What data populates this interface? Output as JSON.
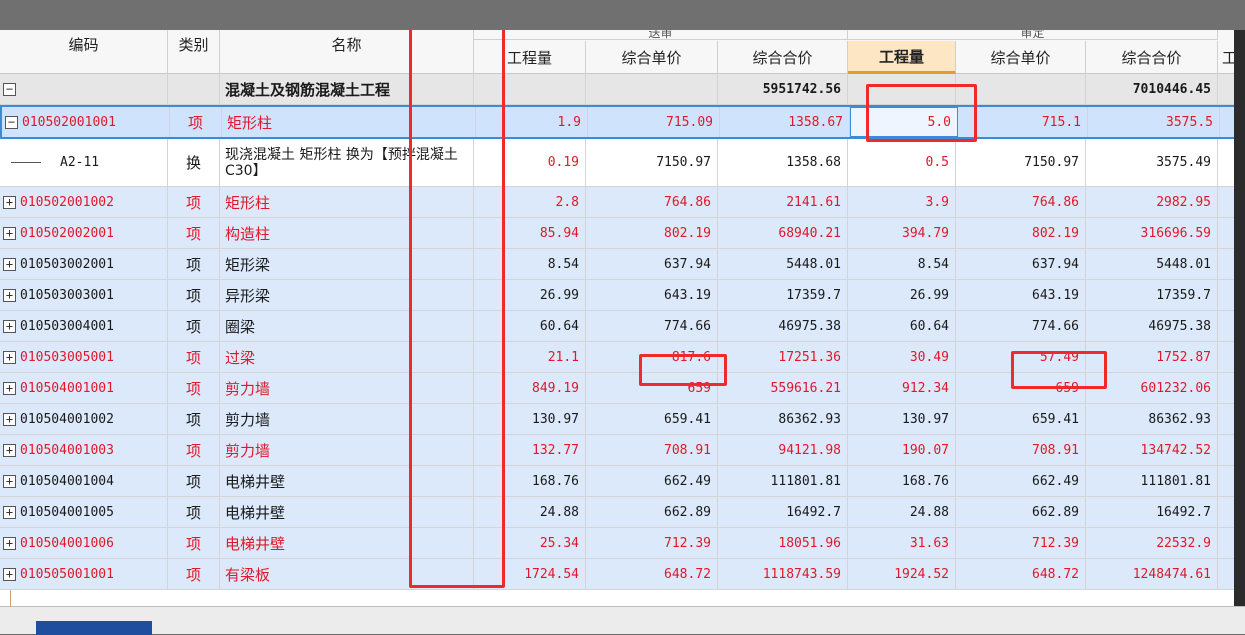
{
  "header": {
    "code": "编码",
    "type": "类别",
    "name": "名称",
    "group1": "送审",
    "group2": "审定",
    "g1": [
      "工程量",
      "综合单价",
      "综合合价"
    ],
    "g2": [
      "工程量",
      "综合单价",
      "综合合价"
    ],
    "cut": "工"
  },
  "rows": [
    {
      "code": "",
      "type": "",
      "name": "混凝土及钢筋混凝土工程",
      "v": [
        "",
        "",
        "5951742.56",
        "",
        "",
        "7010446.45"
      ]
    },
    {
      "code": "010502001001",
      "type": "项",
      "name": "矩形柱",
      "v": [
        "1.9",
        "715.09",
        "1358.67",
        "5.0",
        "715.1",
        "3575.5"
      ]
    },
    {
      "code": "A2-11",
      "type": "换",
      "name": "现浇混凝土 矩形柱  换为【预拌混凝土 C30】",
      "v": [
        "0.19",
        "7150.97",
        "1358.68",
        "0.5",
        "7150.97",
        "3575.49"
      ]
    },
    {
      "code": "010502001002",
      "type": "项",
      "name": "矩形柱",
      "v": [
        "2.8",
        "764.86",
        "2141.61",
        "3.9",
        "764.86",
        "2982.95"
      ]
    },
    {
      "code": "010502002001",
      "type": "项",
      "name": "构造柱",
      "v": [
        "85.94",
        "802.19",
        "68940.21",
        "394.79",
        "802.19",
        "316696.59"
      ]
    },
    {
      "code": "010503002001",
      "type": "项",
      "name": "矩形梁",
      "v": [
        "8.54",
        "637.94",
        "5448.01",
        "8.54",
        "637.94",
        "5448.01"
      ]
    },
    {
      "code": "010503003001",
      "type": "项",
      "name": "异形梁",
      "v": [
        "26.99",
        "643.19",
        "17359.7",
        "26.99",
        "643.19",
        "17359.7"
      ]
    },
    {
      "code": "010503004001",
      "type": "项",
      "name": "圈梁",
      "v": [
        "60.64",
        "774.66",
        "46975.38",
        "60.64",
        "774.66",
        "46975.38"
      ]
    },
    {
      "code": "010503005001",
      "type": "项",
      "name": "过梁",
      "v": [
        "21.1",
        "817.6",
        "17251.36",
        "30.49",
        "57.49",
        "1752.87"
      ]
    },
    {
      "code": "010504001001",
      "type": "项",
      "name": "剪力墙",
      "v": [
        "849.19",
        "659",
        "559616.21",
        "912.34",
        "659",
        "601232.06"
      ]
    },
    {
      "code": "010504001002",
      "type": "项",
      "name": "剪力墙",
      "v": [
        "130.97",
        "659.41",
        "86362.93",
        "130.97",
        "659.41",
        "86362.93"
      ]
    },
    {
      "code": "010504001003",
      "type": "项",
      "name": "剪力墙",
      "v": [
        "132.77",
        "708.91",
        "94121.98",
        "190.07",
        "708.91",
        "134742.52"
      ]
    },
    {
      "code": "010504001004",
      "type": "项",
      "name": "电梯井壁",
      "v": [
        "168.76",
        "662.49",
        "111801.81",
        "168.76",
        "662.49",
        "111801.81"
      ]
    },
    {
      "code": "010504001005",
      "type": "项",
      "name": "电梯井壁",
      "v": [
        "24.88",
        "662.89",
        "16492.7",
        "24.88",
        "662.89",
        "16492.7"
      ]
    },
    {
      "code": "010504001006",
      "type": "项",
      "name": "电梯井壁",
      "v": [
        "25.34",
        "712.39",
        "18051.96",
        "31.63",
        "712.39",
        "22532.9"
      ]
    },
    {
      "code": "010505001001",
      "type": "项",
      "name": "有梁板",
      "v": [
        "1724.54",
        "648.72",
        "1118743.59",
        "1924.52",
        "648.72",
        "1248474.61"
      ]
    }
  ],
  "icons": {
    "expand": "+",
    "collapse": "−"
  },
  "colors": {
    "changed_row_text": "#e0182b",
    "selected_border": "#3b8bd9",
    "annotation": "#ee2a2a",
    "active_header": "#fce6c4"
  }
}
